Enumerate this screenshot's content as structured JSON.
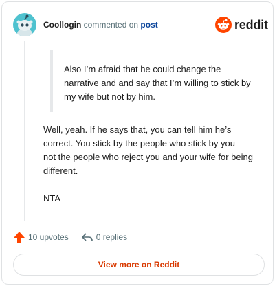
{
  "header": {
    "author": "Coollogin",
    "action": "commented on",
    "post_link": "post",
    "brand": "reddit"
  },
  "quote": {
    "text": "Also I’m afraid that he could change the narrative and and say that I’m willing to stick by my wife but not by him."
  },
  "comment": {
    "paragraphs": [
      "Well, yeah. If he says that, you can tell him he’s correct. You stick by the people who stick by you — not the people who reject you and your wife for being different.",
      "NTA"
    ]
  },
  "footer": {
    "upvotes": "10 upvotes",
    "replies": "0 replies",
    "view_more": "View more on Reddit"
  },
  "colors": {
    "brand_orange": "#ff4500",
    "link_blue": "#0a449b",
    "button_text": "#d93900",
    "avatar_teal": "#2aa8b5"
  },
  "icons": {
    "avatar": "snoo-avatar",
    "logo": "reddit-snoo-logo",
    "upvote": "upvote-arrow-icon",
    "reply": "reply-arrow-icon"
  }
}
